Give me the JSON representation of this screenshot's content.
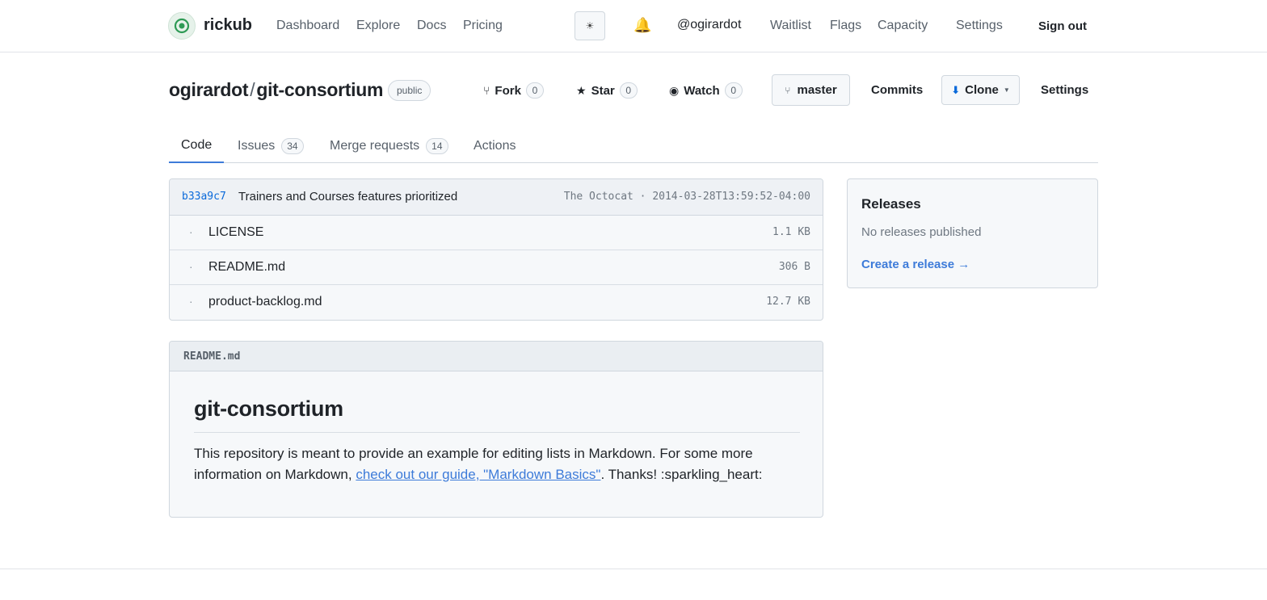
{
  "nav": {
    "brand": "rickub",
    "links": [
      "Dashboard",
      "Explore",
      "Docs",
      "Pricing"
    ],
    "theme_icon": "sun-icon",
    "bell_icon": "bell-icon",
    "user": "@ogirardot",
    "right_links": [
      "Waitlist",
      "Flags",
      "Capacity",
      "Settings"
    ],
    "sign_out": "Sign out"
  },
  "repo": {
    "owner": "ogirardot",
    "separator": "/",
    "name": "git-consortium",
    "visibility": "public",
    "fork_label": "Fork",
    "fork_count": "0",
    "star_label": "Star",
    "star_count": "0",
    "watch_label": "Watch",
    "watch_count": "0",
    "branch": "master",
    "commits_label": "Commits",
    "clone_label": "Clone",
    "settings_label": "Settings"
  },
  "tabs": [
    {
      "label": "Code",
      "count": null,
      "active": true
    },
    {
      "label": "Issues",
      "count": "34",
      "active": false
    },
    {
      "label": "Merge requests",
      "count": "14",
      "active": false
    },
    {
      "label": "Actions",
      "count": null,
      "active": false
    }
  ],
  "latest_commit": {
    "sha": "b33a9c7",
    "message": "Trainers and Courses features prioritized",
    "meta": "The Octocat · 2014-03-28T13:59:52-04:00"
  },
  "files": [
    {
      "name": "LICENSE",
      "size": "1.1 KB"
    },
    {
      "name": "README.md",
      "size": "306 B"
    },
    {
      "name": "product-backlog.md",
      "size": "12.7 KB"
    }
  ],
  "readme": {
    "filename": "README.md",
    "heading": "git-consortium",
    "text_before": "This repository is meant to provide an example for editing lists in Markdown. For some more information on Markdown, ",
    "link_text": "check out our guide, \"Markdown Basics\"",
    "text_after": ". Thanks! :sparkling_heart:"
  },
  "releases": {
    "title": "Releases",
    "empty": "No releases published",
    "create": "Create a release →"
  },
  "colors": {
    "accent": "#3d7bd9",
    "sha_link": "#0969da",
    "border": "#d0d7de",
    "panel_bg": "#f6f8fa"
  }
}
